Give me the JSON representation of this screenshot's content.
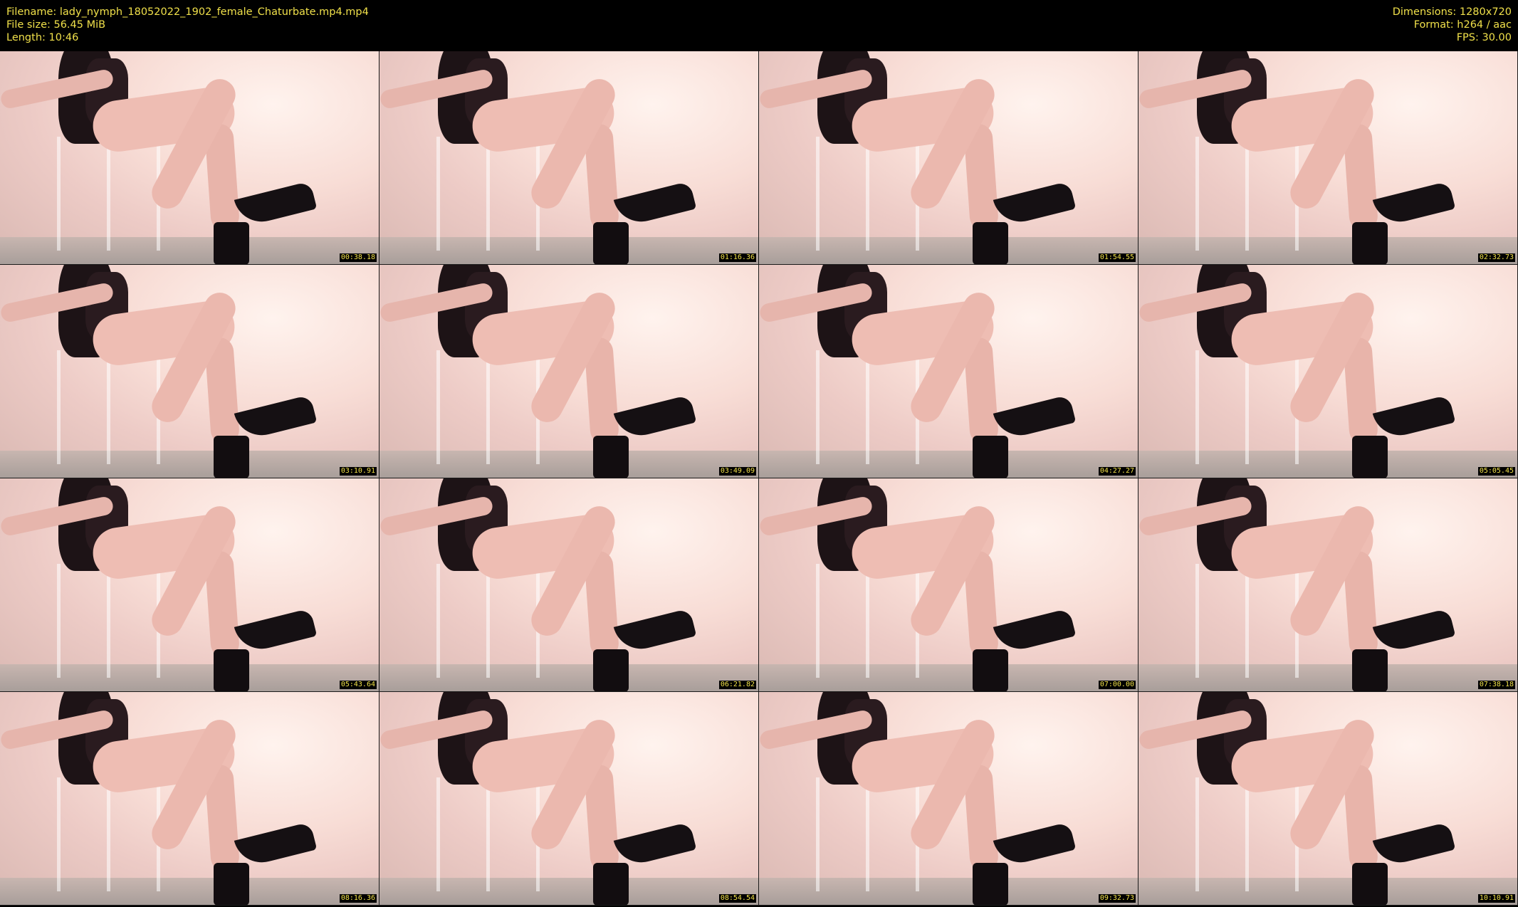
{
  "header": {
    "filename": "Filename: lady_nymph_18052022_1902_female_Chaturbate.mp4.mp4",
    "filesize": "File size: 56.45 MiB",
    "length": "Length: 10:46",
    "dimensions": "Dimensions: 1280x720",
    "format": "Format: h264 / aac",
    "fps": "FPS: 30.00"
  },
  "thumbnails": [
    {
      "timestamp": "00:38.18"
    },
    {
      "timestamp": "01:16.36"
    },
    {
      "timestamp": "01:54.55"
    },
    {
      "timestamp": "02:32.73"
    },
    {
      "timestamp": "03:10.91"
    },
    {
      "timestamp": "03:49.09"
    },
    {
      "timestamp": "04:27.27"
    },
    {
      "timestamp": "05:05.45"
    },
    {
      "timestamp": "05:43.64"
    },
    {
      "timestamp": "06:21.82"
    },
    {
      "timestamp": "07:00.00"
    },
    {
      "timestamp": "07:38.18"
    },
    {
      "timestamp": "08:16.36"
    },
    {
      "timestamp": "08:54.54"
    },
    {
      "timestamp": "09:32.73"
    },
    {
      "timestamp": "10:10.91"
    }
  ]
}
